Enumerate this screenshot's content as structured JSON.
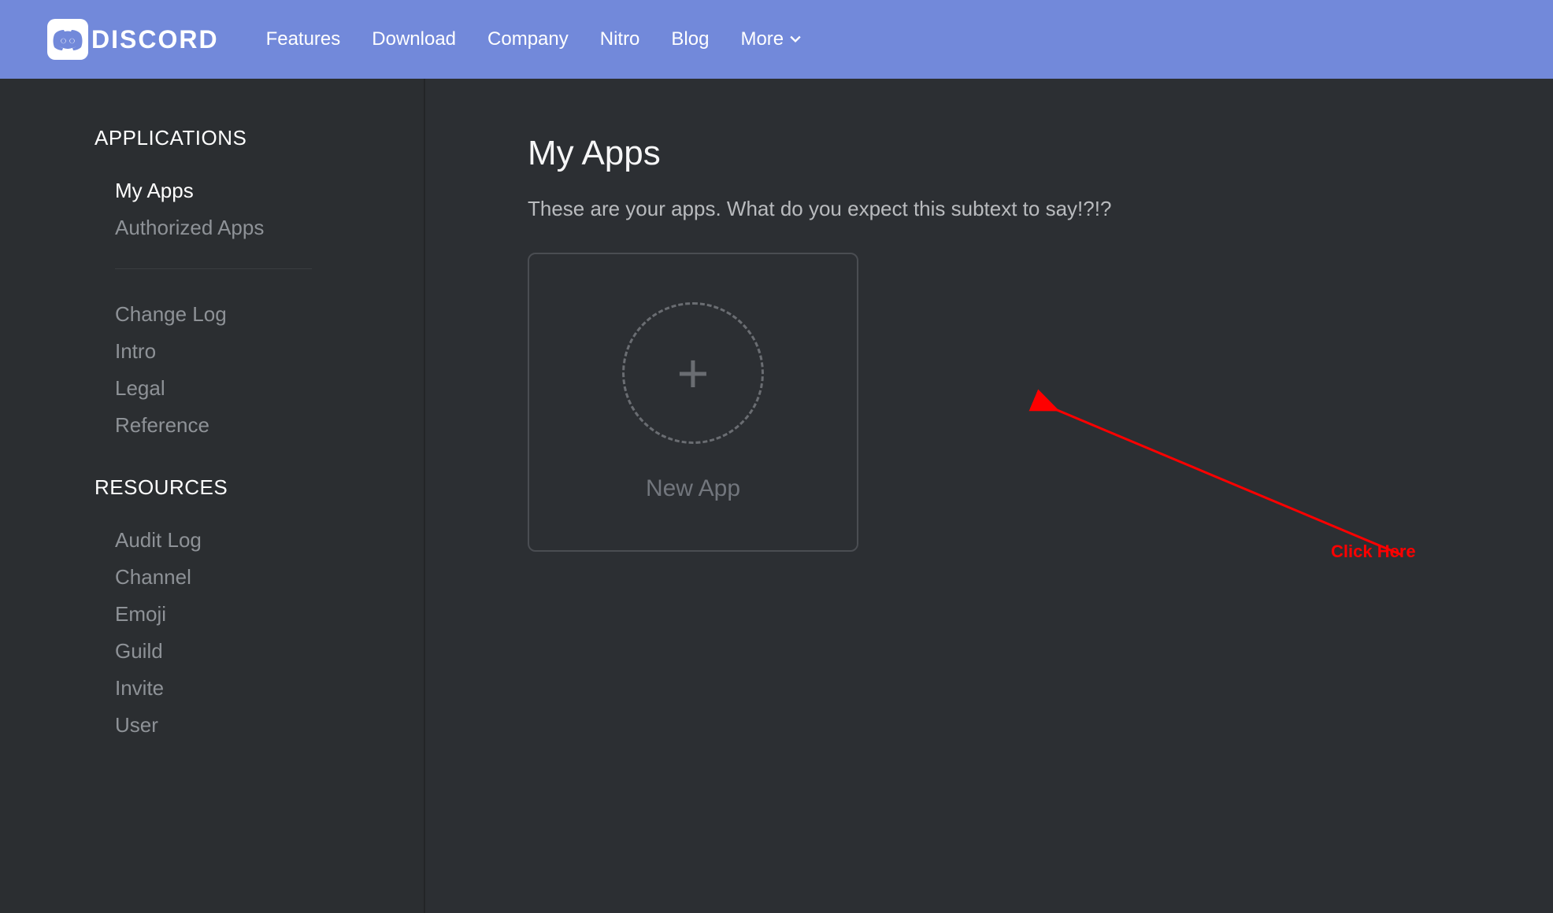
{
  "brand": {
    "name": "DISCORD"
  },
  "nav": {
    "items": [
      {
        "label": "Features"
      },
      {
        "label": "Download"
      },
      {
        "label": "Company"
      },
      {
        "label": "Nitro"
      },
      {
        "label": "Blog"
      },
      {
        "label": "More"
      }
    ]
  },
  "sidebar": {
    "section1": {
      "header": "APPLICATIONS",
      "items": [
        {
          "label": "My Apps",
          "active": true
        },
        {
          "label": "Authorized Apps",
          "active": false
        }
      ]
    },
    "section2": {
      "items": [
        {
          "label": "Change Log"
        },
        {
          "label": "Intro"
        },
        {
          "label": "Legal"
        },
        {
          "label": "Reference"
        }
      ]
    },
    "section3": {
      "header": "RESOURCES",
      "items": [
        {
          "label": "Audit Log"
        },
        {
          "label": "Channel"
        },
        {
          "label": "Emoji"
        },
        {
          "label": "Guild"
        },
        {
          "label": "Invite"
        },
        {
          "label": "User"
        }
      ]
    }
  },
  "main": {
    "title": "My Apps",
    "subtext": "These are your apps. What do you expect this subtext to say!?!?",
    "newAppLabel": "New App"
  },
  "annotation": {
    "text": "Click Here",
    "color": "#fe0000"
  }
}
